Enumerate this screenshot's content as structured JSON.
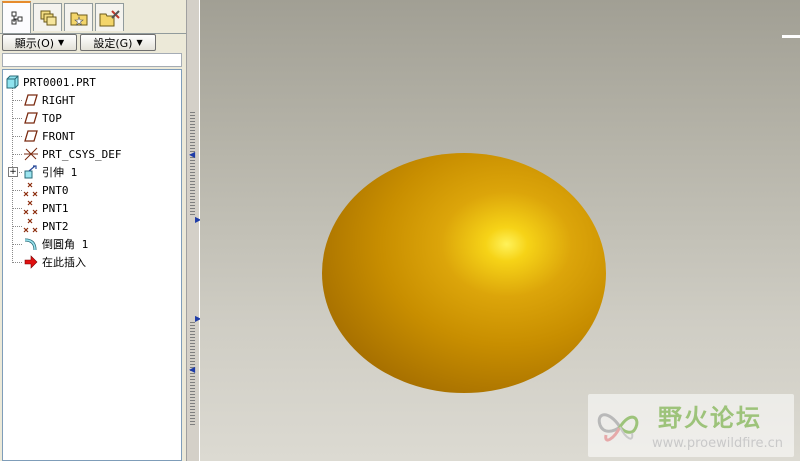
{
  "navigator": {
    "tabs": [
      {
        "name": "model-tree",
        "icon": "model-tree-icon",
        "active": true
      },
      {
        "name": "layers",
        "icon": "layers-icon",
        "active": false
      },
      {
        "name": "favorites",
        "icon": "folder-star-icon",
        "active": false
      },
      {
        "name": "tools",
        "icon": "folder-tools-icon",
        "active": false
      }
    ],
    "show_menu_label": "顯示(O)",
    "settings_menu_label": "設定(G)"
  },
  "model_tree": {
    "root": "PRT0001.PRT",
    "items": [
      {
        "label": "RIGHT",
        "icon": "datum-plane-icon"
      },
      {
        "label": "TOP",
        "icon": "datum-plane-icon"
      },
      {
        "label": "FRONT",
        "icon": "datum-plane-icon"
      },
      {
        "label": "PRT_CSYS_DEF",
        "icon": "coordinate-system-icon"
      },
      {
        "label": "引伸 1",
        "icon": "extrude-icon",
        "expandable": true
      },
      {
        "label": "PNT0",
        "icon": "datum-point-icon"
      },
      {
        "label": "PNT1",
        "icon": "datum-point-icon"
      },
      {
        "label": "PNT2",
        "icon": "datum-point-icon"
      },
      {
        "label": "倒圓角 1",
        "icon": "round-icon"
      },
      {
        "label": "在此插入",
        "icon": "insert-here-arrow-icon"
      }
    ]
  },
  "graphics": {
    "model_color": "#c88e00",
    "background_top": "#a19f94",
    "background_bottom": "#dcdad2"
  },
  "watermark": {
    "title": "野火论坛",
    "url": "www.proewildfire.cn"
  }
}
